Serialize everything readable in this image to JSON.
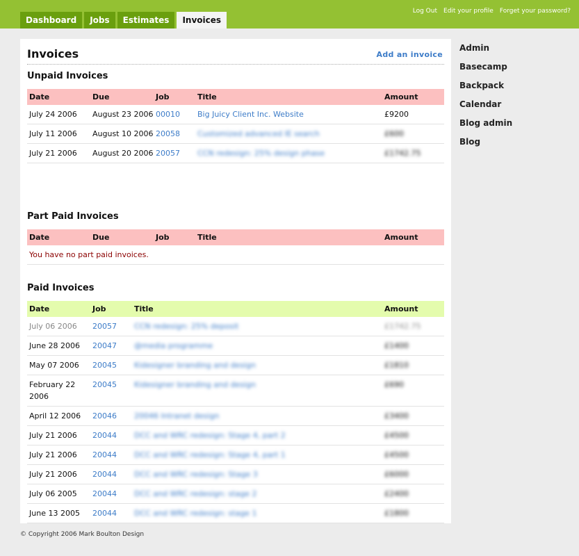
{
  "tabs": [
    "Dashboard",
    "Jobs",
    "Estimates",
    "Invoices"
  ],
  "top_links": [
    "Log Out",
    "Edit your profile",
    "Forget your password?"
  ],
  "page": {
    "title": "Invoices",
    "add_link": "Add an invoice"
  },
  "unpaid": {
    "heading": "Unpaid Invoices",
    "headers": [
      "Date",
      "Due",
      "Job",
      "Title",
      "Amount"
    ],
    "rows": [
      {
        "date": "July 24 2006",
        "due": "August 23 2006",
        "job": "00010",
        "title": "Big Juicy Client Inc. Website",
        "amount": "£9200"
      },
      {
        "date": "July 11 2006",
        "due": "August 10 2006",
        "job": "20058",
        "title": "Customized advanced IE search",
        "amount": "£600"
      },
      {
        "date": "July 21 2006",
        "due": "August 20 2006",
        "job": "20057",
        "title": "CCN redesign: 25% design phase",
        "amount": "£1742.75"
      }
    ]
  },
  "part_paid": {
    "heading": "Part Paid Invoices",
    "headers": [
      "Date",
      "Due",
      "Job",
      "Title",
      "Amount"
    ],
    "empty_message": "You have no part paid invoices."
  },
  "paid": {
    "heading": "Paid Invoices",
    "headers": [
      "Date",
      "Job",
      "Title",
      "Amount"
    ],
    "rows": [
      {
        "date": "July 06 2006",
        "job": "20057",
        "title": "CCN redesign: 25% deposit",
        "amount": "£1742.75"
      },
      {
        "date": "June 28 2006",
        "job": "20047",
        "title": "@media programme",
        "amount": "£1400"
      },
      {
        "date": "May 07 2006",
        "job": "20045",
        "title": "Kidesigner branding and design",
        "amount": "£1810"
      },
      {
        "date": "February 22 2006",
        "job": "20045",
        "title": "Kidesigner branding and design",
        "amount": "£690"
      },
      {
        "date": "April 12 2006",
        "job": "20046",
        "title": "20046 Intranet design",
        "amount": "£3400"
      },
      {
        "date": "July 21 2006",
        "job": "20044",
        "title": "DCC and WRC redesign: Stage 4, part 2",
        "amount": "£4500"
      },
      {
        "date": "July 21 2006",
        "job": "20044",
        "title": "DCC and WRC redesign: Stage 4, part 1",
        "amount": "£4500"
      },
      {
        "date": "July 21 2006",
        "job": "20044",
        "title": "DCC and WRC redesign: Stage 3",
        "amount": "£6000"
      },
      {
        "date": "July 06 2005",
        "job": "20044",
        "title": "DCC and WRC redesign: stage 2",
        "amount": "£2400"
      },
      {
        "date": "June 13 2005",
        "job": "20044",
        "title": "DCC and WRC redesign: stage 1",
        "amount": "£1800"
      }
    ]
  },
  "sidebar": [
    "Admin",
    "Basecamp",
    "Backpack",
    "Calendar",
    "Blog admin",
    "Blog"
  ],
  "footer": "© Copyright 2006 Mark Boulton Design"
}
